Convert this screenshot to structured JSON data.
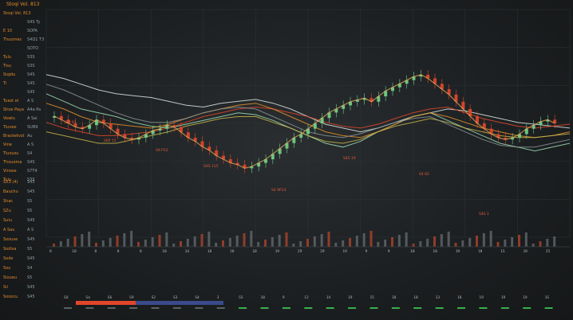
{
  "window": {
    "title": "Stoqi Vol. 813"
  },
  "side_panel": {
    "rows": [
      {
        "k": "Stoqi Vol. 813",
        "v": ""
      },
      {
        "k": "",
        "v": "S4S Ty"
      },
      {
        "k": "E 10",
        "v": "SOFA"
      },
      {
        "k": "Thuomes",
        "v": "S4Q1 T3"
      },
      {
        "k": "",
        "v": "SOTO"
      },
      {
        "k": "Tulu",
        "v": "S3S"
      },
      {
        "k": "Tisu",
        "v": "S3S"
      },
      {
        "k": "Siqidu",
        "v": "S4S"
      },
      {
        "k": "Ti",
        "v": "S4S"
      },
      {
        "k": "",
        "v": "S45"
      },
      {
        "k": "Tuest el",
        "v": "A S"
      },
      {
        "k": "Shoe Paya",
        "v": "A4a Pa"
      },
      {
        "k": "Vowts",
        "v": "A Sai"
      },
      {
        "k": "Tiuvee",
        "v": "SUB9"
      },
      {
        "k": "Bracketvol",
        "v": "Au"
      },
      {
        "k": "Vine",
        "v": "A S"
      },
      {
        "k": "Tiuouzu",
        "v": "S4"
      },
      {
        "k": "Thouema",
        "v": "S4S"
      },
      {
        "k": "Vinose",
        "v": "S7T4"
      },
      {
        "k": "Tuiu",
        "v": "S3S"
      }
    ],
    "bottom_rows": [
      {
        "k": "SX3 (4)",
        "v": "S45"
      },
      {
        "k": "Bauchu",
        "v": "S45"
      },
      {
        "k": "Shac",
        "v": "S5"
      },
      {
        "k": "SZu",
        "v": "S5"
      },
      {
        "k": "Suiu",
        "v": "S45"
      },
      {
        "k": "A Sau",
        "v": "A S"
      },
      {
        "k": "Soouse",
        "v": "S45"
      },
      {
        "k": "Sodisa",
        "v": "S5"
      },
      {
        "k": "Sode",
        "v": "S45"
      },
      {
        "k": "Sou",
        "v": "S4"
      },
      {
        "k": "Sioueu",
        "v": "S5"
      },
      {
        "k": "Sii",
        "v": "S45"
      },
      {
        "k": "Sooocu",
        "v": "S45"
      }
    ]
  },
  "annotations": [
    {
      "text": "S5P 91"
    },
    {
      "text": "S6P 15"
    },
    {
      "text": "S9 P12"
    },
    {
      "text": "S4S 115"
    },
    {
      "text": "S4 9P13"
    },
    {
      "text": "S4S 19"
    },
    {
      "text": "S4 82"
    },
    {
      "text": "S4S 1"
    }
  ],
  "footer": {
    "ticks": [
      "8",
      "10",
      "8",
      "8",
      "8",
      "10",
      "14",
      "18",
      "18",
      "10",
      "19",
      "29",
      "29",
      "19",
      "9",
      "9",
      "10",
      "10",
      "19",
      "18",
      "1S",
      "18",
      "25"
    ],
    "row_label_values": [
      "SU",
      "Sa",
      "S6",
      "S9",
      "S2",
      "S3",
      "S4",
      "3",
      "SS",
      "10",
      "9",
      "12",
      "14",
      "19",
      "15",
      "18",
      "18",
      "13",
      "18",
      "19",
      "19",
      "19",
      "1S"
    ],
    "accent_colors": {
      "red": "#e2462a",
      "blue": "#3a4a8a",
      "green": "#3fd65a",
      "orange": "#e8902a"
    }
  },
  "chart_data": {
    "type": "line",
    "title": "",
    "xlabel": "",
    "ylabel": "",
    "candles_close": [
      62,
      60,
      58,
      56,
      55,
      57,
      60,
      58,
      55,
      52,
      50,
      49,
      50,
      52,
      54,
      55,
      57,
      56,
      53,
      50,
      48,
      45,
      43,
      40,
      38,
      36,
      35,
      33,
      34,
      36,
      38,
      41,
      44,
      47,
      50,
      52,
      55,
      58,
      61,
      64,
      66,
      68,
      70,
      71,
      72,
      70,
      73,
      76,
      78,
      80,
      82,
      84,
      85,
      83,
      80,
      77,
      74,
      70,
      66,
      62,
      58,
      55,
      52,
      50,
      49,
      50,
      52,
      55,
      57,
      59,
      60,
      58
    ],
    "series": [
      {
        "color": "#d9e7e2",
        "values": [
          30,
          32,
          35,
          38,
          40,
          41,
          42,
          44,
          46,
          47,
          45,
          44,
          43,
          45,
          48,
          52,
          56,
          58,
          60,
          58,
          55,
          52,
          50,
          48,
          49,
          51,
          53,
          55,
          56,
          57,
          58
        ]
      },
      {
        "color": "#9be0b6",
        "values": [
          40,
          44,
          48,
          50,
          52,
          55,
          57,
          58,
          56,
          54,
          52,
          50,
          51,
          54,
          58,
          62,
          66,
          68,
          65,
          60,
          56,
          52,
          50,
          54,
          58,
          62,
          66,
          68,
          70,
          68,
          66
        ]
      },
      {
        "color": "#e2462a",
        "values": [
          55,
          58,
          60,
          62,
          62,
          61,
          60,
          58,
          55,
          52,
          50,
          48,
          47,
          48,
          50,
          52,
          55,
          57,
          58,
          56,
          53,
          50,
          48,
          47,
          50,
          53,
          55,
          57,
          58,
          57,
          56
        ]
      },
      {
        "color": "#e8902a",
        "values": [
          45,
          48,
          52,
          55,
          56,
          57,
          58,
          56,
          53,
          50,
          48,
          46,
          45,
          48,
          52,
          56,
          60,
          62,
          63,
          60,
          56,
          52,
          50,
          52,
          55,
          58,
          60,
          62,
          63,
          62,
          60
        ]
      },
      {
        "color": "#c7b64a",
        "values": [
          60,
          62,
          64,
          66,
          66,
          64,
          62,
          60,
          57,
          55,
          53,
          52,
          52,
          55,
          58,
          62,
          65,
          66,
          64,
          60,
          57,
          55,
          53,
          55,
          58,
          60,
          62,
          63,
          63,
          62,
          61
        ]
      },
      {
        "color": "#8a9497",
        "values": [
          35,
          38,
          42,
          46,
          50,
          53,
          55,
          55,
          53,
          50,
          48,
          47,
          48,
          52,
          56,
          60,
          62,
          63,
          61,
          58,
          55,
          53,
          52,
          56,
          60,
          64,
          67,
          68,
          68,
          66,
          64
        ]
      }
    ]
  }
}
